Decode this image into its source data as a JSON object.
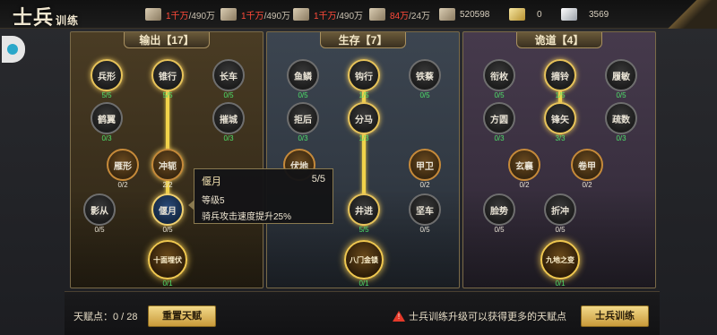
{
  "header": {
    "title": "士兵",
    "title_small": "训练",
    "resources": [
      {
        "icon": "wheat-icon",
        "current": "1千万",
        "max": "/490万"
      },
      {
        "icon": "lumber-icon",
        "current": "1千万",
        "max": "/490万"
      },
      {
        "icon": "stone-icon",
        "current": "1千万",
        "max": "/490万"
      },
      {
        "icon": "iron-icon",
        "current": "84万",
        "max": "/24万"
      },
      {
        "icon": "sword-icon",
        "value": "520598"
      },
      {
        "icon": "gold-ingot-icon",
        "value": "0"
      },
      {
        "icon": "silver-ingot-icon",
        "value": "3569"
      }
    ]
  },
  "panels": [
    {
      "title": "输出【17】",
      "nodes": [
        {
          "label": "兵形",
          "count": "5/5"
        },
        {
          "label": "锥行",
          "count": "5/5"
        },
        {
          "label": "长车",
          "count": "0/5"
        },
        {
          "label": "鹤翼",
          "count": "0/3"
        },
        {
          "label": "摧城",
          "count": "0/3"
        },
        {
          "label": "雁形",
          "count": "0/2"
        },
        {
          "label": "冲轭",
          "count": "2/2"
        },
        {
          "label": "影从",
          "count": "0/5"
        },
        {
          "label": "偃月",
          "count": "0/5"
        }
      ],
      "ultimate": {
        "label": "十面埋伏",
        "count": "0/1"
      }
    },
    {
      "title": "生存【7】",
      "nodes": [
        {
          "label": "鱼鳞",
          "count": "0/5"
        },
        {
          "label": "钩行",
          "count": "1/5"
        },
        {
          "label": "铁蔡",
          "count": "0/5"
        },
        {
          "label": "拒后",
          "count": "0/3"
        },
        {
          "label": "分马",
          "count": "1/3"
        },
        {
          "label": "伏地",
          "count": ""
        },
        {
          "label": "甲卫",
          "count": "0/2"
        },
        {
          "label": "井进",
          "count": "5/5"
        },
        {
          "label": "坚车",
          "count": "0/5"
        }
      ],
      "ultimate": {
        "label": "八门金锁",
        "count": "0/1"
      }
    },
    {
      "title": "诡道【4】",
      "nodes": [
        {
          "label": "衔枚",
          "count": "0/5"
        },
        {
          "label": "摘铃",
          "count": "1/5"
        },
        {
          "label": "履敏",
          "count": "0/5"
        },
        {
          "label": "方圆",
          "count": "0/3"
        },
        {
          "label": "锋矢",
          "count": "3/3"
        },
        {
          "label": "疏数",
          "count": "0/3"
        },
        {
          "label": "玄襄",
          "count": "0/2"
        },
        {
          "label": "卷甲",
          "count": "0/2"
        },
        {
          "label": "脸势",
          "count": "0/5"
        },
        {
          "label": "折冲",
          "count": "0/5"
        }
      ],
      "ultimate": {
        "label": "九地之变",
        "count": "0/1"
      }
    }
  ],
  "tooltip": {
    "name": "偃月",
    "count": "5/5",
    "level": "等级5",
    "effect": "骑兵攻击速度提升25%"
  },
  "bottom": {
    "points_label": "天赋点：0 / 28",
    "reset_label": "重置天赋",
    "hint": "士兵训练升级可以获得更多的天赋点",
    "train_label": "士兵训练"
  }
}
